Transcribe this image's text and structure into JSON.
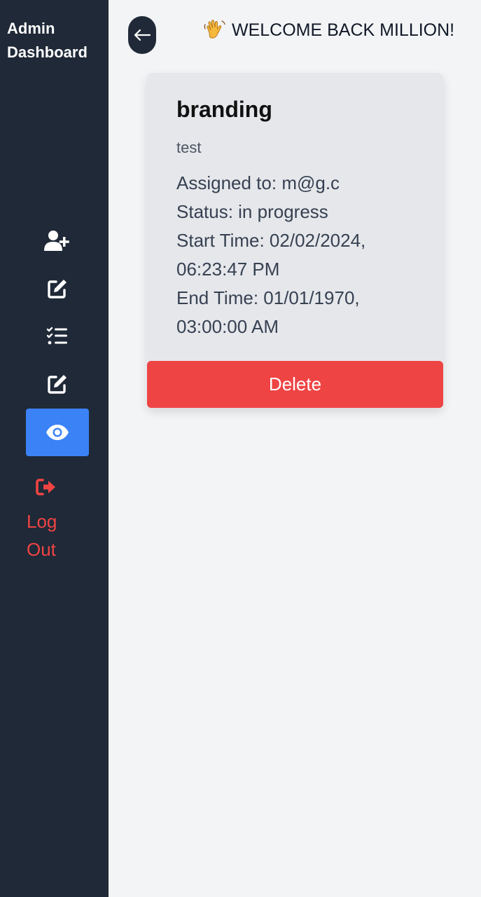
{
  "sidebar": {
    "title": "Admin\nDashboard",
    "items": [
      {
        "icon": "user-plus-icon"
      },
      {
        "icon": "edit-icon"
      },
      {
        "icon": "task-list-icon"
      },
      {
        "icon": "edit-icon"
      },
      {
        "icon": "eye-icon",
        "active": true
      }
    ],
    "logout": {
      "label": "Log\nOut",
      "icon": "logout-icon"
    }
  },
  "header": {
    "back_icon": "arrow-left-icon",
    "welcome_text": "WELCOME BACK MILLION!",
    "wave_icon": "waving-hand-icon"
  },
  "task": {
    "title": "branding",
    "description": "test",
    "assigned_to": "Assigned to: m@g.c",
    "status": "Status: in progress",
    "start_time": "Start Time: 02/02/2024, 06:23:47 PM",
    "end_time": "End Time: 01/01/1970, 03:00:00 AM",
    "delete_label": "Delete"
  },
  "colors": {
    "sidebar_bg": "#1f2937",
    "active_bg": "#3b82f6",
    "danger": "#ef4444",
    "card_bg": "#e5e7eb",
    "page_bg": "#f3f4f6"
  }
}
